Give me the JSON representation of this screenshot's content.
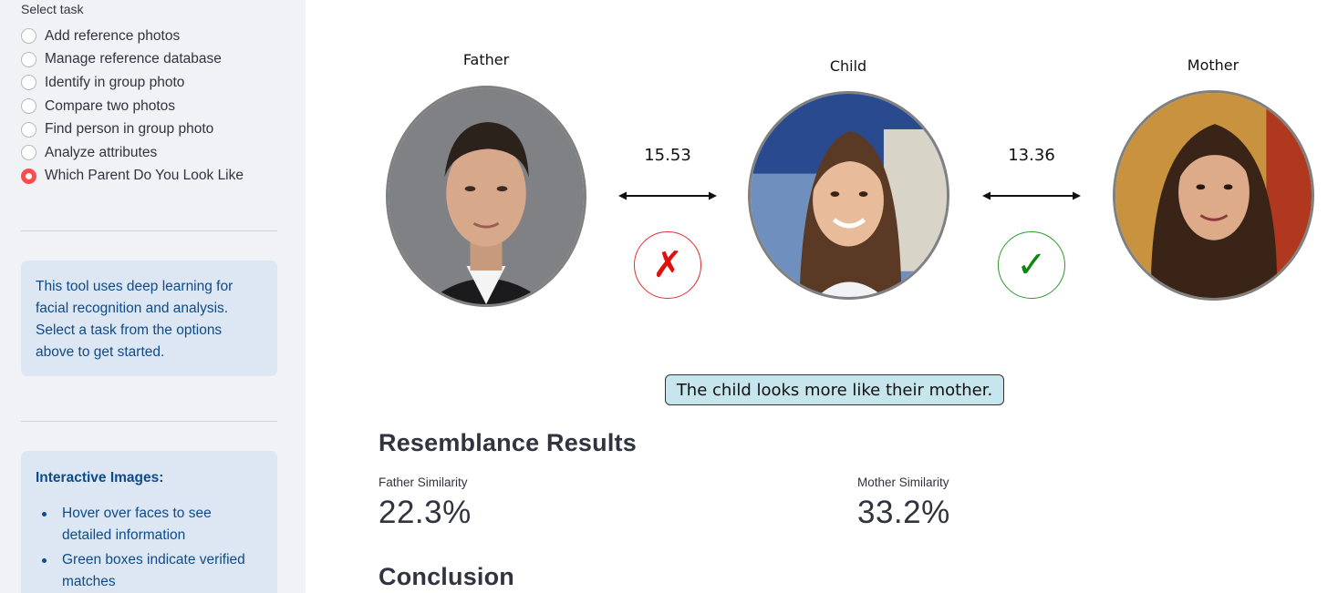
{
  "sidebar": {
    "select_label": "Select task",
    "options": [
      {
        "label": "Add reference photos",
        "selected": false
      },
      {
        "label": "Manage reference database",
        "selected": false
      },
      {
        "label": "Identify in group photo",
        "selected": false
      },
      {
        "label": "Compare two photos",
        "selected": false
      },
      {
        "label": "Find person in group photo",
        "selected": false
      },
      {
        "label": "Analyze attributes",
        "selected": false
      },
      {
        "label": "Which Parent Do You Look Like",
        "selected": true
      }
    ],
    "info_text": "This tool uses deep learning for facial recognition and analysis. Select a task from the options above to get started.",
    "interactive": {
      "heading": "Interactive Images:",
      "bullets": [
        "Hover over faces to see detailed information",
        "Green boxes indicate verified matches"
      ]
    }
  },
  "figure": {
    "father_label": "Father",
    "child_label": "Child",
    "mother_label": "Mother",
    "father_distance": "15.53",
    "mother_distance": "13.36",
    "father_verdict": "✗",
    "mother_verdict": "✓",
    "caption": "The child looks more like their mother."
  },
  "results": {
    "heading": "Resemblance Results",
    "father_label": "Father Similarity",
    "father_value": "22.3%",
    "mother_label": "Mother Similarity",
    "mother_value": "33.2%"
  },
  "conclusion": {
    "heading": "Conclusion"
  },
  "colors": {
    "accent": "#ff4b4b",
    "sidebar_bg": "#f0f2f6",
    "info_bg": "#dde7f3",
    "info_text": "#0d4b8a",
    "match_green": "#118811",
    "mismatch_red": "#e01010",
    "caption_bg": "#c6e5ec"
  }
}
